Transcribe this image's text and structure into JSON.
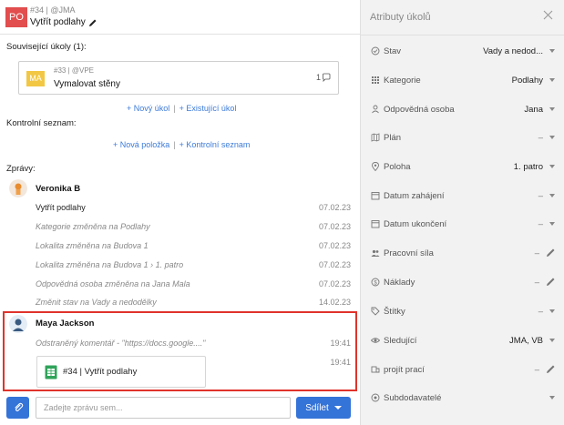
{
  "header": {
    "badge": "PO",
    "code": "#34 | @JMA",
    "title": "Vytřít podlahy"
  },
  "related": {
    "label": "Související úkoly (1):",
    "card": {
      "badge": "MA",
      "code": "#33 | @VPE",
      "title": "Vymalovat stěny",
      "comment_count": "1"
    },
    "links": [
      "+ Nový úkol",
      "+ Existující úkol"
    ]
  },
  "checklist": {
    "label": "Kontrolní seznam:",
    "links": [
      "+ Nová položka",
      "+ Kontrolní seznam"
    ]
  },
  "messages": {
    "label": "Zprávy:",
    "groups": [
      {
        "author": "Veronika B",
        "items": [
          {
            "text": "Vytřít podlahy",
            "date": "07.02.23"
          },
          {
            "text": "Kategorie změněna na Podlahy",
            "date": "07.02.23"
          },
          {
            "text": "Lokalita změněna na Budova 1",
            "date": "07.02.23"
          },
          {
            "text": "Lokalita změněna na Budova 1 › 1. patro",
            "date": "07.02.23"
          },
          {
            "text": "Odpovědná osoba změněna na Jana Mala",
            "date": "07.02.23"
          },
          {
            "text": "Změnit stav na Vady a nedodělky",
            "date": "14.02.23"
          }
        ]
      },
      {
        "author": "Maya Jackson",
        "items": [
          {
            "text": "Odstraněný komentář - \"https://docs.google....\"",
            "date": "19:41"
          },
          {
            "text": "#34 | Vytřít podlahy",
            "date": "19:41"
          }
        ]
      }
    ]
  },
  "composer": {
    "placeholder": "Zadejte zprávu sem...",
    "share_label": "Sdílet"
  },
  "attributes": {
    "title": "Atributy úkolů",
    "items": [
      {
        "icon": "status-icon",
        "label": "Stav",
        "value": "Vady a nedod..."
      },
      {
        "icon": "category-grid-icon",
        "label": "Kategorie",
        "value": "Podlahy"
      },
      {
        "icon": "person-icon",
        "label": "Odpovědná osoba",
        "value": "Jana"
      },
      {
        "icon": "map-icon",
        "label": "Plán",
        "value": "–"
      },
      {
        "icon": "location-pin-icon",
        "label": "Poloha",
        "value": "1. patro"
      },
      {
        "icon": "calendar-icon",
        "label": "Datum zahájení",
        "value": "–"
      },
      {
        "icon": "calendar-icon",
        "label": "Datum ukončení",
        "value": "–"
      },
      {
        "icon": "people-icon",
        "label": "Pracovní síla",
        "value": "–"
      },
      {
        "icon": "coin-icon",
        "label": "Náklady",
        "value": "–"
      },
      {
        "icon": "tag-icon",
        "label": "Štítky",
        "value": "–"
      },
      {
        "icon": "eye-icon",
        "label": "Sledující",
        "value": "JMA, VB"
      },
      {
        "icon": "work-icon",
        "label": "projít prací",
        "value": "–"
      },
      {
        "icon": "subcontractor-icon",
        "label": "Subdodavatelé",
        "value": ""
      }
    ]
  },
  "colors": {
    "accent": "#3473d8",
    "highlight": "#e0332b",
    "badge_po": "#e24d4d",
    "badge_ma": "#f2c744"
  }
}
